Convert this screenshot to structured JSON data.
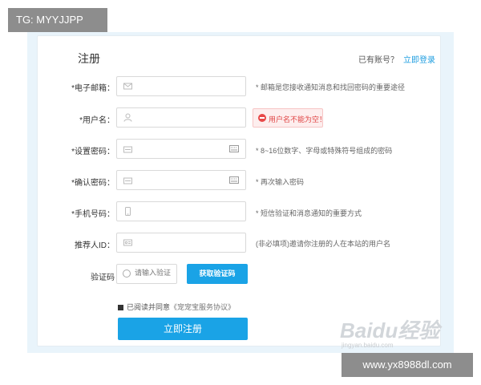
{
  "overlay_tag": "TG: MYYJJPP",
  "overlay_url": "www.yx8988dl.com",
  "form": {
    "title": "注册",
    "have_account": "已有账号？",
    "login_link": "立即登录",
    "email": {
      "label": "*电子邮箱：",
      "hint": "* 邮箱是您接收通知消息和找回密码的重要途径"
    },
    "username": {
      "label": "*用户名：",
      "error": "用户名不能为空！"
    },
    "password": {
      "label": "*设置密码：",
      "hint": "* 8~16位数字、字母或特殊符号组成的密码"
    },
    "confirm": {
      "label": "*确认密码：",
      "hint": "* 再次输入密码"
    },
    "phone": {
      "label": "*手机号码：",
      "hint": "* 短信验证和消息通知的重要方式"
    },
    "referrer": {
      "label": "推荐人ID：",
      "hint": "(非必填项)邀请你注册的人在本站的用户名"
    },
    "captcha": {
      "label": "验证码",
      "placeholder": "请输入验证",
      "button": "获取验证码"
    },
    "agree_text": "已阅读并同意",
    "agree_protocol": "《宠宠宝服务协议》",
    "agree_checked": true,
    "submit": "立即注册"
  },
  "watermark": {
    "logo": "Baidu经验",
    "url": "jingyan.baidu.com"
  },
  "colors": {
    "accent": "#1aa3e6",
    "error": "#e84848",
    "background": "#e9f4fb"
  }
}
